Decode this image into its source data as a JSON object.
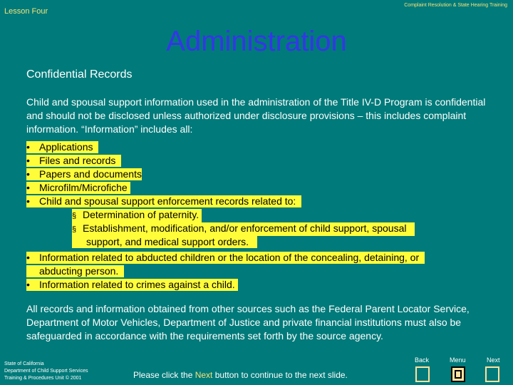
{
  "header": {
    "lesson": "Lesson Four",
    "course": "Complaint Resolution & State Hearing Training",
    "title": "Administration",
    "subtitle": "Confidential Records"
  },
  "intro": "Child and spousal support information used in the administration of the Title IV-D Program is confidential and should not be disclosed unless authorized under disclosure provisions – this includes complaint information. “Information” includes all:",
  "bullets": {
    "b1": "Applications",
    "b2": "Files and records",
    "b3": "Papers and documents",
    "b4": "Microfilm/Microfiche",
    "b5": "Child and spousal support enforcement records related to:",
    "s1": "Determination of paternity.",
    "s2a": "Establishment, modification, and/or enforcement of child support, spousal",
    "s2b": "support, and medical support orders.",
    "b6a": "Information related to abducted children or the location of the concealing, detaining, or",
    "b6b": "abducting person.",
    "b7": "Information related to crimes against a child.",
    "bullet_symbol": "•",
    "sub_symbol": "§"
  },
  "outro": "All records and information obtained from other sources such as the Federal Parent Locator Service, Department of Motor Vehicles, Department of Justice and private financial institutions must also be safeguarded in accordance with the requirements set forth by the source agency.",
  "footer": {
    "org_line1": "State of California",
    "org_line2": "Department of Child Support Services",
    "org_line3": "Training & Procedures Unit © 2001",
    "prompt_before": "Please click the ",
    "prompt_next": "Next",
    "prompt_after": " button to continue to the next slide."
  },
  "nav": {
    "back": "Back",
    "menu": "Menu",
    "next": "Next"
  },
  "colors": {
    "background": "#007a7a",
    "title": "#3535e8",
    "highlight": "#fffc3a",
    "accent": "#f2e37a",
    "button": "#ffe2a0"
  }
}
